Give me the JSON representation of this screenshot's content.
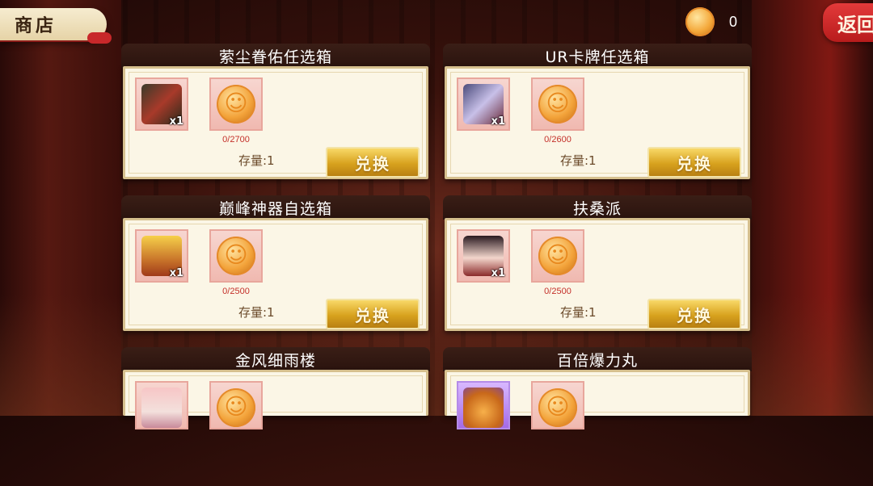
{
  "header": {
    "title": "商店",
    "currency_amount": "0",
    "back_label": "返回"
  },
  "cards": [
    {
      "title": "萦尘眷佑任选箱",
      "item_qty": "x1",
      "item_icon": "weapon-item-icon",
      "cost_progress": "0/2700",
      "stock": "存量:1",
      "button": "兑换"
    },
    {
      "title": "UR卡牌任选箱",
      "item_qty": "x1",
      "item_icon": "card-pack-icon",
      "cost_progress": "0/2600",
      "stock": "存量:1",
      "button": "兑换"
    },
    {
      "title": "巅峰神器自选箱",
      "item_qty": "x1",
      "item_icon": "treasure-chest-icon",
      "cost_progress": "0/2500",
      "stock": "存量:1",
      "button": "兑换"
    },
    {
      "title": "扶桑派",
      "item_qty": "x1",
      "item_icon": "character-portrait-icon",
      "cost_progress": "0/2500",
      "stock": "存量:1",
      "button": "兑换"
    },
    {
      "title": "金风细雨楼",
      "item_qty": "",
      "item_icon": "character-portrait-icon",
      "cost_progress": "",
      "stock": "",
      "button": ""
    },
    {
      "title": "百倍爆力丸",
      "item_qty": "",
      "item_icon": "roast-chicken-icon",
      "cost_progress": "",
      "stock": "",
      "button": ""
    }
  ],
  "colors": {
    "accent_red": "#c8282a",
    "button_gold": "#d8a21e",
    "card_bg": "#fbf6e6",
    "progress_red": "#c4302a"
  }
}
